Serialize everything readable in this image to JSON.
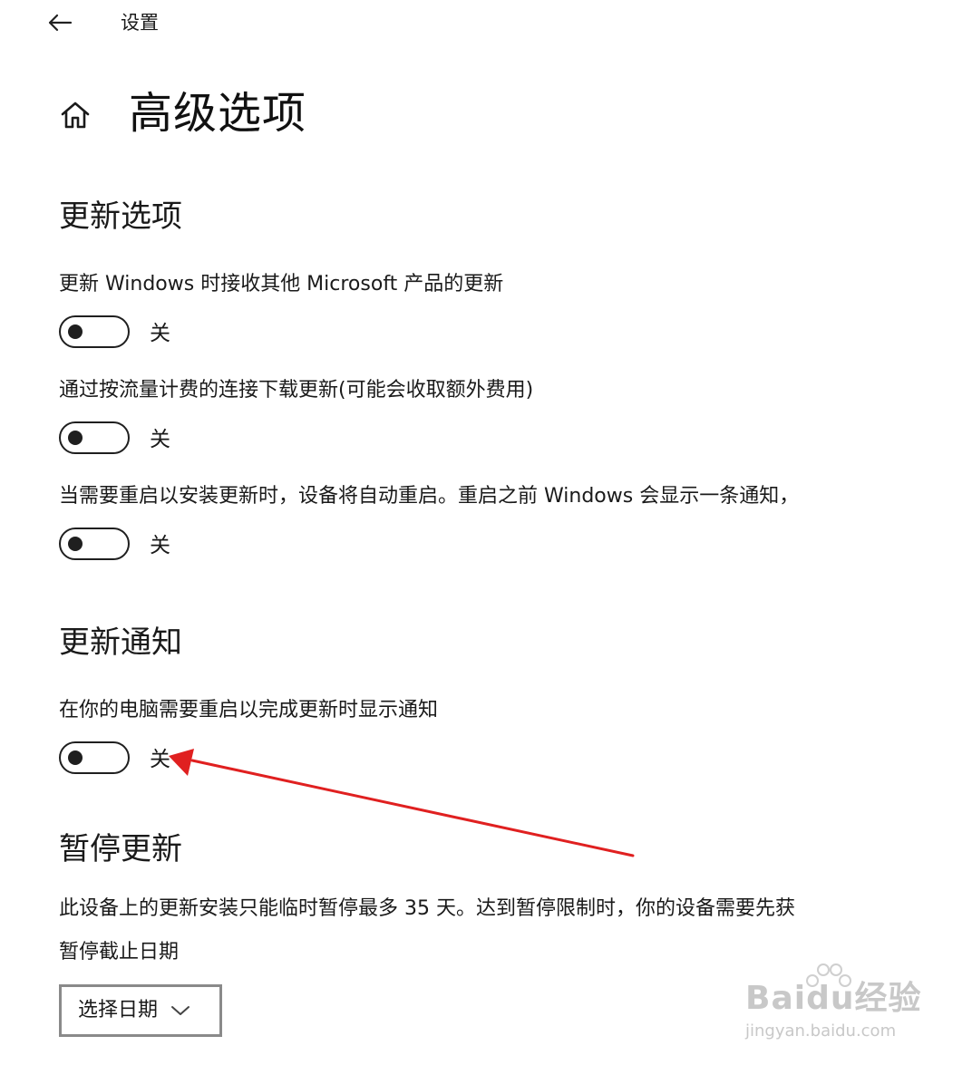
{
  "header": {
    "app_title": "设置"
  },
  "page": {
    "title": "高级选项"
  },
  "sections": {
    "update_options": {
      "title": "更新选项",
      "settings": [
        {
          "label": "更新 Windows 时接收其他 Microsoft 产品的更新",
          "state": "关"
        },
        {
          "label": "通过按流量计费的连接下载更新(可能会收取额外费用)",
          "state": "关"
        },
        {
          "label": "当需要重启以安装更新时，设备将自动重启。重启之前 Windows 会显示一条通知，",
          "state": "关"
        }
      ]
    },
    "update_notifications": {
      "title": "更新通知",
      "settings": [
        {
          "label": "在你的电脑需要重启以完成更新时显示通知",
          "state": "关"
        }
      ]
    },
    "pause_updates": {
      "title": "暂停更新",
      "description": "此设备上的更新安装只能临时暂停最多 35 天。达到暂停限制时，你的设备需要先获",
      "date_label": "暂停截止日期",
      "date_picker_value": "选择日期"
    }
  },
  "watermark": {
    "brand": "Baidu经验",
    "url": "jingyan.baidu.com"
  },
  "annotation": {
    "color": "#e02020"
  }
}
